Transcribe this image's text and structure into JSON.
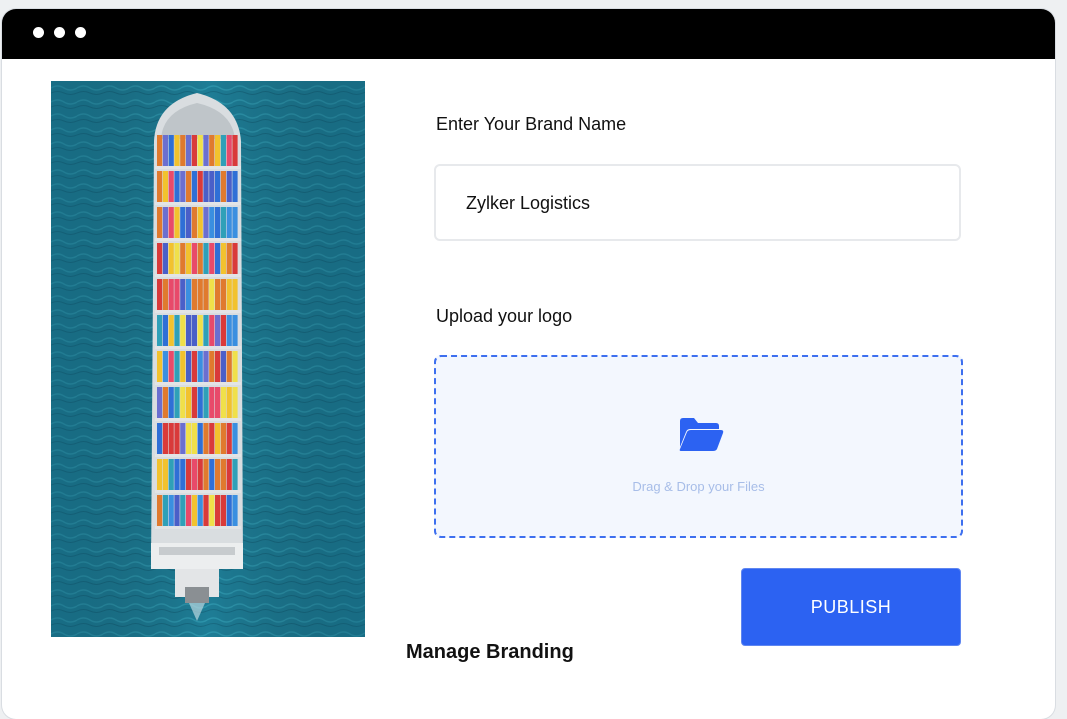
{
  "window": {
    "controls": [
      "dot",
      "dot",
      "dot"
    ]
  },
  "image": {
    "subject": "container-ship-aerial-photo"
  },
  "form": {
    "brand_label": "Enter Your Brand Name",
    "brand_value": "Zylker Logistics",
    "logo_label": "Upload your logo",
    "dropzone_icon": "folder-open-icon",
    "dropzone_text": "Drag & Drop your Files",
    "publish_label": "PUBLISH"
  },
  "caption": "Manage Branding",
  "colors": {
    "accent": "#2c62f2",
    "dropzone_border": "#3d6fef",
    "dropzone_bg": "#f3f7fe",
    "ocean": "#1f7f97"
  }
}
